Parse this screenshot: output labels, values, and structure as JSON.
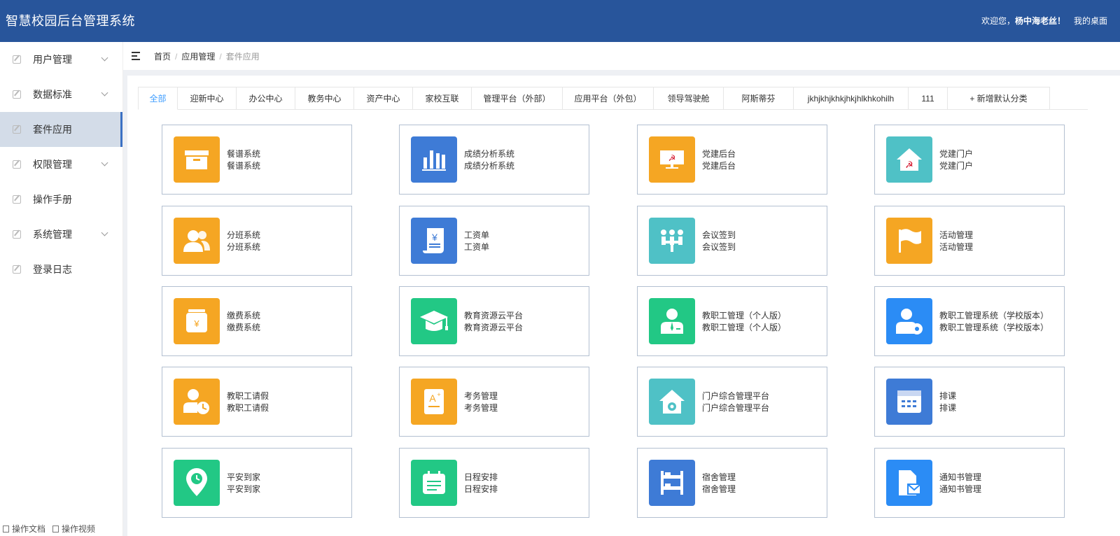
{
  "header": {
    "title": "智慧校园后台管理系统",
    "welcome": "欢迎您，",
    "user": "杨中海老丝！",
    "desk": "我的桌面"
  },
  "sidebar": {
    "items": [
      {
        "label": "用户管理",
        "expandable": true
      },
      {
        "label": "数据标准",
        "expandable": true
      },
      {
        "label": "套件应用",
        "expandable": false,
        "active": true
      },
      {
        "label": "权限管理",
        "expandable": true
      },
      {
        "label": "操作手册",
        "expandable": false
      },
      {
        "label": "系统管理",
        "expandable": true
      },
      {
        "label": "登录日志",
        "expandable": false
      }
    ],
    "bottom": {
      "doc": "操作文档",
      "video": "操作视频"
    }
  },
  "breadcrumb": {
    "home": "首页",
    "parent": "应用管理",
    "current": "套件应用"
  },
  "tabs": [
    "全部",
    "迎新中心",
    "办公中心",
    "教务中心",
    "资产中心",
    "家校互联",
    "管理平台（外部）",
    "应用平台（外包）",
    "领导驾驶舱",
    "阿斯蒂芬",
    "jkhjkhjkhkjhkjhlkhkohilh",
    "111",
    "+ 新增默认分类"
  ],
  "apps": [
    {
      "name": "餐谱系统",
      "sub": "餐谱系统",
      "color": "orange",
      "icon": "box-icon"
    },
    {
      "name": "成绩分析系统",
      "sub": "成绩分析系统",
      "color": "blue",
      "icon": "bar-chart-icon"
    },
    {
      "name": "党建后台",
      "sub": "党建后台",
      "color": "orange",
      "icon": "party-screen-icon"
    },
    {
      "name": "党建门户",
      "sub": "党建门户",
      "color": "teal",
      "icon": "party-house-icon"
    },
    {
      "name": "分班系统",
      "sub": "分班系统",
      "color": "orange",
      "icon": "users-icon"
    },
    {
      "name": "工资单",
      "sub": "工资单",
      "color": "blue",
      "icon": "payroll-icon"
    },
    {
      "name": "会议签到",
      "sub": "会议签到",
      "color": "teal",
      "icon": "meeting-icon"
    },
    {
      "name": "活动管理",
      "sub": "活动管理",
      "color": "orange",
      "icon": "flag-icon"
    },
    {
      "name": "缴费系统",
      "sub": "缴费系统",
      "color": "orange",
      "icon": "payment-icon"
    },
    {
      "name": "教育资源云平台",
      "sub": "教育资源云平台",
      "color": "green",
      "icon": "graduation-cap-icon"
    },
    {
      "name": "教职工管理（个人版）",
      "sub": "教职工管理（个人版）",
      "color": "green",
      "icon": "staff-icon"
    },
    {
      "name": "教职工管理系统（学校版本）",
      "sub": "教职工管理系统（学校版本）",
      "color": "brightblue",
      "icon": "staff-settings-icon"
    },
    {
      "name": "教职工请假",
      "sub": "教职工请假",
      "color": "orange",
      "icon": "leave-clock-icon"
    },
    {
      "name": "考务管理",
      "sub": "考务管理",
      "color": "orange",
      "icon": "exam-icon"
    },
    {
      "name": "门户综合管理平台",
      "sub": "门户综合管理平台",
      "color": "teal",
      "icon": "house-gear-icon"
    },
    {
      "name": "排课",
      "sub": "排课",
      "color": "blue",
      "icon": "calendar-icon"
    },
    {
      "name": "平安到家",
      "sub": "平安到家",
      "color": "green",
      "icon": "location-clock-icon"
    },
    {
      "name": "日程安排",
      "sub": "日程安排",
      "color": "green",
      "icon": "schedule-icon"
    },
    {
      "name": "宿舍管理",
      "sub": "宿舍管理",
      "color": "blue",
      "icon": "bunk-bed-icon"
    },
    {
      "name": "通知书管理",
      "sub": "通知书管理",
      "color": "brightblue",
      "icon": "notice-icon"
    }
  ]
}
